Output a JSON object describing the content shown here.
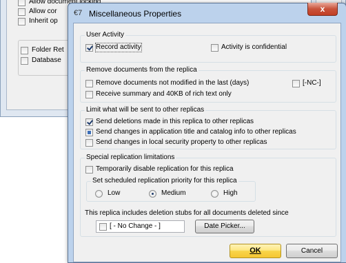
{
  "background_window": {
    "items": [
      {
        "label": "Allow document locking",
        "checked": false
      },
      {
        "label": "Allow cor",
        "checked": false
      },
      {
        "label": "Inherit op",
        "checked": false
      },
      {
        "label": "Folder Ret",
        "checked": false
      },
      {
        "label": "Database",
        "checked": false
      }
    ]
  },
  "dialog": {
    "title": "Miscellaneous Properties",
    "title_icon": "€7",
    "close_glyph": "x"
  },
  "user_activity": {
    "legend": "User Activity",
    "record_activity": {
      "label": "Record activity",
      "checked": true
    },
    "confidential": {
      "label": "Activity is confidential",
      "checked": false
    }
  },
  "remove_docs": {
    "legend": "Remove documents from the replica",
    "not_modified": {
      "label": "Remove documents not modified in the last (days)",
      "checked": false
    },
    "nc": {
      "label": "[-NC-]",
      "checked": false
    },
    "summary": {
      "label": "Receive summary and 40KB of rich text only",
      "checked": false
    }
  },
  "limit": {
    "legend": "Limit what will be sent to other replicas",
    "items": [
      {
        "label": "Send deletions made in this replica to other replicas",
        "state": "checked"
      },
      {
        "label": "Send changes in application title and catalog info to other replicas",
        "state": "partial"
      },
      {
        "label": "Send changes in local security property to other replicas",
        "state": "unchecked"
      }
    ]
  },
  "special": {
    "legend": "Special replication limitations",
    "disable": {
      "label": "Temporarily disable replication for this replica",
      "checked": false
    },
    "priority": {
      "legend": "Set scheduled replication priority for this replica",
      "options": [
        {
          "label": "Low",
          "selected": false
        },
        {
          "label": "Medium",
          "selected": true
        },
        {
          "label": "High",
          "selected": false
        }
      ]
    },
    "stubs_text": "This replica includes deletion stubs for all documents deleted since",
    "no_change": {
      "label": "[ - No Change - ]",
      "checked": false
    },
    "date_picker": "Date Picker..."
  },
  "buttons": {
    "ok": "OK",
    "cancel": "Cancel"
  }
}
